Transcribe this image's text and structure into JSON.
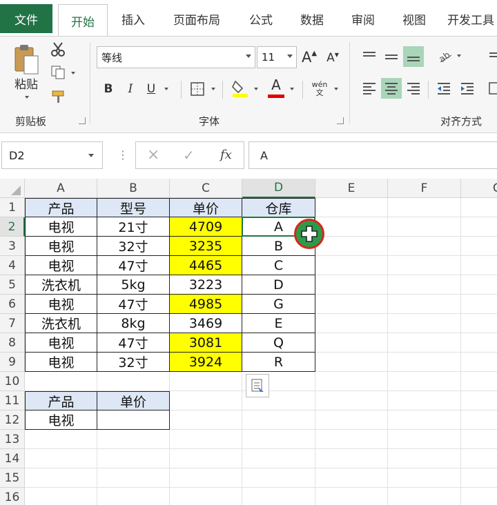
{
  "tabs": {
    "file": "文件",
    "items": [
      "开始",
      "插入",
      "页面布局",
      "公式",
      "数据",
      "审阅",
      "视图",
      "开发工具"
    ],
    "active_index": 0
  },
  "ribbon": {
    "clipboard": {
      "paste_label": "粘贴",
      "group_label": "剪贴板"
    },
    "font": {
      "font_name": "等线",
      "font_size": "11",
      "group_label": "字体",
      "phonetic": "wén\n文",
      "bold": "B",
      "italic": "I",
      "underline": "U",
      "grow": "A",
      "shrink": "A",
      "font_color": "A"
    },
    "alignment": {
      "group_label": "对齐方式"
    }
  },
  "formula_bar": {
    "name_box": "D2",
    "cancel": "×",
    "enter": "✓",
    "fx": "fx",
    "value": "A"
  },
  "sheet": {
    "columns": [
      "A",
      "B",
      "C",
      "D",
      "E",
      "F",
      "G"
    ],
    "rows": [
      "1",
      "2",
      "3",
      "4",
      "5",
      "6",
      "7",
      "8",
      "9",
      "10",
      "11",
      "12",
      "13",
      "14",
      "15",
      "16"
    ],
    "selected_cell": "D2",
    "table1": {
      "headers": [
        "产品",
        "型号",
        "单价",
        "仓库"
      ],
      "rows": [
        [
          "电视",
          "21寸",
          "4709",
          "A"
        ],
        [
          "电视",
          "32寸",
          "3235",
          "B"
        ],
        [
          "电视",
          "47寸",
          "4465",
          "C"
        ],
        [
          "洗衣机",
          "5kg",
          "3223",
          "D"
        ],
        [
          "电视",
          "47寸",
          "4985",
          "G"
        ],
        [
          "洗衣机",
          "8kg",
          "3469",
          "E"
        ],
        [
          "电视",
          "47寸",
          "3081",
          "Q"
        ],
        [
          "电视",
          "32寸",
          "3924",
          "R"
        ]
      ],
      "highlighted_rows": [
        0,
        1,
        2,
        4,
        6,
        7
      ]
    },
    "table2": {
      "headers": [
        "产品",
        "单价"
      ],
      "rows": [
        [
          "电视",
          ""
        ]
      ]
    }
  },
  "colors": {
    "accent": "#217346",
    "header_fill": "#dde7f5",
    "highlight": "#ffff00",
    "fill_cursor_ring": "#d9261c"
  }
}
